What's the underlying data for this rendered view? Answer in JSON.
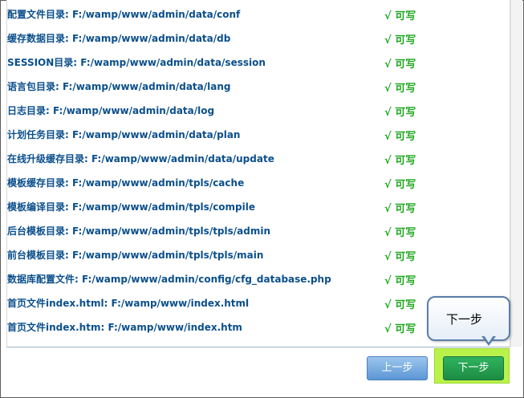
{
  "directories": [
    {
      "label": "配置文件目录: F:/wamp/www/admin/data/conf",
      "status": "√ 可写"
    },
    {
      "label": "缓存数据目录: F:/wamp/www/admin/data/db",
      "status": "√ 可写"
    },
    {
      "label": "SESSION目录: F:/wamp/www/admin/data/session",
      "status": "√ 可写"
    },
    {
      "label": "语言包目录: F:/wamp/www/admin/data/lang",
      "status": "√ 可写"
    },
    {
      "label": "日志目录: F:/wamp/www/admin/data/log",
      "status": "√ 可写"
    },
    {
      "label": "计划任务目录: F:/wamp/www/admin/data/plan",
      "status": "√ 可写"
    },
    {
      "label": "在线升级缓存目录: F:/wamp/www/admin/data/update",
      "status": "√ 可写"
    },
    {
      "label": "模板缓存目录: F:/wamp/www/admin/tpls/cache",
      "status": "√ 可写"
    },
    {
      "label": "模板编译目录: F:/wamp/www/admin/tpls/compile",
      "status": "√ 可写"
    },
    {
      "label": "后台模板目录: F:/wamp/www/admin/tpls/tpls/admin",
      "status": "√ 可写"
    },
    {
      "label": "前台模板目录: F:/wamp/www/admin/tpls/tpls/main",
      "status": "√ 可写"
    },
    {
      "label": "数据库配置文件: F:/wamp/www/admin/config/cfg_database.php",
      "status": "√ 可写"
    },
    {
      "label": "首页文件index.html: F:/wamp/www/index.html",
      "status": "√ 可写"
    },
    {
      "label": "首页文件index.htm: F:/wamp/www/index.htm",
      "status": "√ 可写"
    }
  ],
  "buttons": {
    "prev_label": "上一步",
    "next_label": "下一步"
  },
  "tooltip": {
    "text": "下一步"
  },
  "colors": {
    "path_text": "#0b4f8c",
    "status_ok": "#22a722",
    "next_button": "#1d8c43",
    "prev_button": "#5b96d4",
    "highlight": "#b9f24a"
  }
}
